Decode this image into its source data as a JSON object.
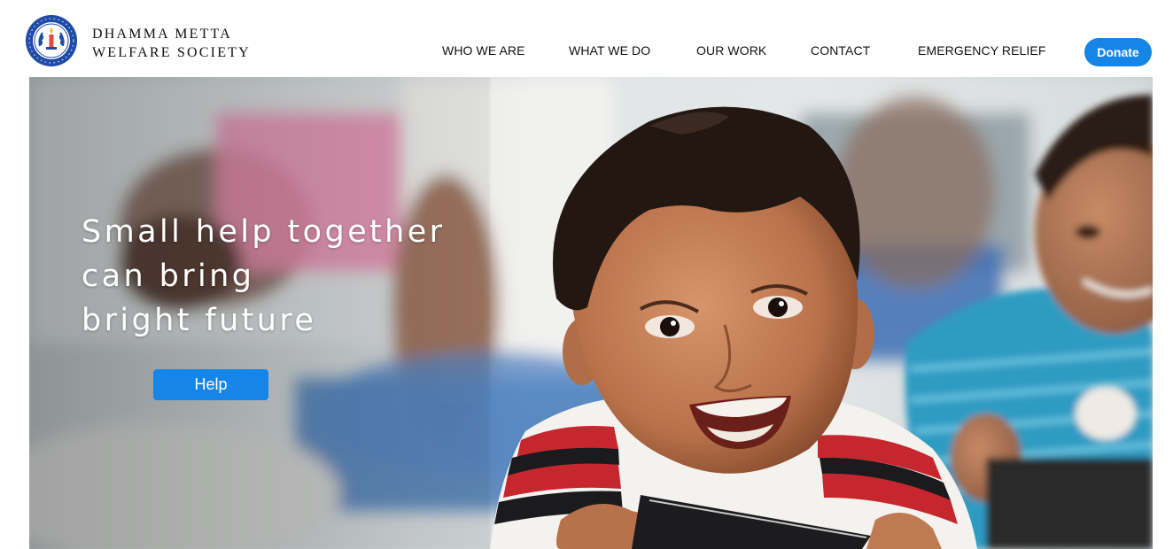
{
  "brand": {
    "line1": "DHAMMA METTA",
    "line2": "WELFARE SOCIETY",
    "logo_icon": "society-emblem-icon"
  },
  "nav": {
    "items": [
      {
        "label": "WHO WE ARE"
      },
      {
        "label": "WHAT WE DO"
      },
      {
        "label": "OUR WORK"
      },
      {
        "label": "CONTACT"
      },
      {
        "label": "EMERGENCY RELIEF"
      }
    ],
    "donate_label": "Donate"
  },
  "hero": {
    "title_lines": [
      "Small help together",
      "can bring",
      "bright future"
    ],
    "cta_label": "Help",
    "image_alt": "smiling-children-photo"
  },
  "colors": {
    "accent": "#1585e8",
    "logo_ring": "#1f4aa8",
    "text": "#111111",
    "hero_text": "#ffffff"
  }
}
